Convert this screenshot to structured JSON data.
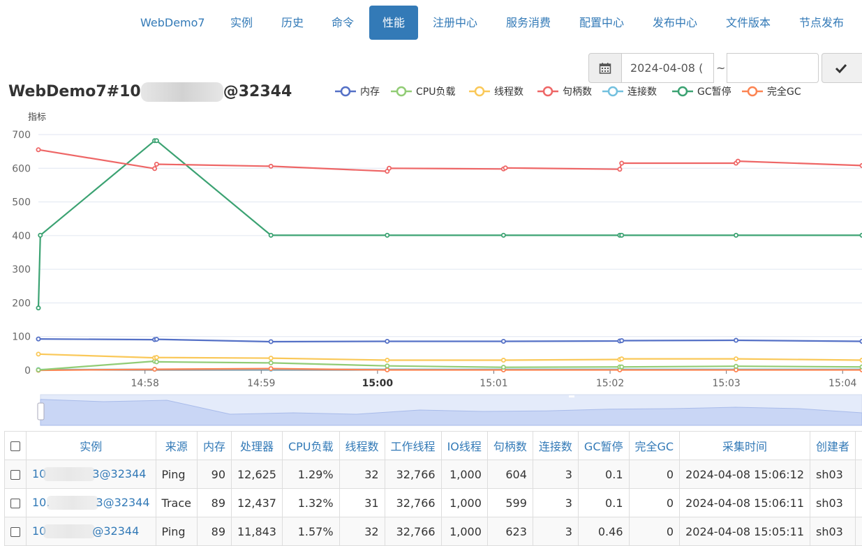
{
  "nav": {
    "items": [
      "WebDemo7",
      "实例",
      "历史",
      "命令",
      "性能",
      "注册中心",
      "服务消费",
      "配置中心",
      "发布中心",
      "文件版本",
      "节点发布"
    ],
    "active_index": 4
  },
  "datebar": {
    "start_date": "2024-04-08 (",
    "separator": "~",
    "end_date": "",
    "calendar_icon": "calendar-icon",
    "ok_icon": "check-icon"
  },
  "chart": {
    "title_prefix": "WebDemo7#10",
    "title_suffix": "@32344"
  },
  "chart_data": {
    "type": "line",
    "title": "WebDemo7#10…@32344",
    "ylabel": "指标",
    "ylim": [
      0,
      700
    ],
    "yticks": [
      0,
      100,
      200,
      300,
      400,
      500,
      600,
      700
    ],
    "xlim": [
      "14:57:05",
      "15:04:10"
    ],
    "xticks": [
      {
        "t": "14:58:00",
        "label": "14:58",
        "bold": false
      },
      {
        "t": "14:59:00",
        "label": "14:59",
        "bold": false
      },
      {
        "t": "15:00:00",
        "label": "15:00",
        "bold": true
      },
      {
        "t": "15:01:00",
        "label": "15:01",
        "bold": false
      },
      {
        "t": "15:02:00",
        "label": "15:02",
        "bold": false
      },
      {
        "t": "15:03:00",
        "label": "15:03",
        "bold": false
      },
      {
        "t": "15:04:00",
        "label": "15:04",
        "bold": false
      }
    ],
    "legend_position": "top",
    "grid": true,
    "series": [
      {
        "name": "内存",
        "color": "#5470c6",
        "points": [
          [
            "14:57:05",
            93
          ],
          [
            "14:58:05",
            91
          ],
          [
            "14:58:06",
            92
          ],
          [
            "14:59:05",
            85
          ],
          [
            "15:00:05",
            86
          ],
          [
            "15:01:05",
            86
          ],
          [
            "15:02:05",
            87
          ],
          [
            "15:02:06",
            88
          ],
          [
            "15:03:05",
            89
          ],
          [
            "15:04:10",
            86
          ]
        ]
      },
      {
        "name": "CPU负载",
        "color": "#91cc75",
        "points": [
          [
            "14:57:05",
            1
          ],
          [
            "14:58:05",
            27
          ],
          [
            "14:58:06",
            25
          ],
          [
            "14:59:05",
            22
          ],
          [
            "15:00:05",
            13
          ],
          [
            "15:01:05",
            9
          ],
          [
            "15:02:05",
            10
          ],
          [
            "15:02:06",
            10
          ],
          [
            "15:03:05",
            12
          ],
          [
            "15:04:10",
            10
          ]
        ]
      },
      {
        "name": "线程数",
        "color": "#fac858",
        "points": [
          [
            "14:57:05",
            48
          ],
          [
            "14:58:05",
            37
          ],
          [
            "14:58:06",
            38
          ],
          [
            "14:59:05",
            36
          ],
          [
            "15:00:05",
            30
          ],
          [
            "15:01:05",
            30
          ],
          [
            "15:02:05",
            32
          ],
          [
            "15:02:06",
            34
          ],
          [
            "15:03:05",
            34
          ],
          [
            "15:04:10",
            30
          ]
        ]
      },
      {
        "name": "句柄数",
        "color": "#ee6666",
        "points": [
          [
            "14:57:05",
            655
          ],
          [
            "14:58:05",
            599
          ],
          [
            "14:58:06",
            612
          ],
          [
            "14:59:05",
            606
          ],
          [
            "15:00:05",
            591
          ],
          [
            "15:00:06",
            600
          ],
          [
            "15:01:05",
            598
          ],
          [
            "15:01:06",
            601
          ],
          [
            "15:02:05",
            597
          ],
          [
            "15:02:06",
            615
          ],
          [
            "15:03:05",
            615
          ],
          [
            "15:03:06",
            621
          ],
          [
            "15:04:10",
            608
          ]
        ]
      },
      {
        "name": "连接数",
        "color": "#73c0de",
        "points": [
          [
            "14:57:05",
            2
          ],
          [
            "14:58:05",
            3
          ],
          [
            "14:59:05",
            3
          ],
          [
            "15:00:05",
            3
          ],
          [
            "15:01:05",
            3
          ],
          [
            "15:02:05",
            3
          ],
          [
            "15:03:05",
            3
          ],
          [
            "15:04:10",
            3
          ]
        ]
      },
      {
        "name": "GC暂停",
        "color": "#3ba272",
        "points": [
          [
            "14:57:05",
            185
          ],
          [
            "14:57:06",
            401
          ],
          [
            "14:58:05",
            682
          ],
          [
            "14:58:06",
            682
          ],
          [
            "14:59:05",
            401
          ],
          [
            "15:00:05",
            401
          ],
          [
            "15:01:05",
            401
          ],
          [
            "15:02:05",
            401
          ],
          [
            "15:02:06",
            401
          ],
          [
            "15:03:05",
            401
          ],
          [
            "15:04:10",
            401
          ]
        ]
      },
      {
        "name": "完全GC",
        "color": "#fc8452",
        "points": [
          [
            "14:57:05",
            0
          ],
          [
            "14:58:05",
            3
          ],
          [
            "14:59:05",
            5
          ],
          [
            "15:00:05",
            1
          ],
          [
            "15:01:05",
            1
          ],
          [
            "15:02:05",
            1
          ],
          [
            "15:03:05",
            1
          ],
          [
            "15:04:10",
            1
          ]
        ]
      }
    ],
    "overview": {
      "values": [
        93,
        85,
        90,
        40,
        45,
        40,
        55,
        50,
        52,
        58,
        60,
        65,
        60,
        45
      ]
    }
  },
  "table": {
    "headers": [
      "实例",
      "来源",
      "内存",
      "处理器",
      "CPU负载",
      "线程数",
      "工作线程",
      "IO线程",
      "句柄数",
      "连接数",
      "GC暂停",
      "完全GC",
      "采集时间",
      "创建者"
    ],
    "rows": [
      {
        "inst_a": "10",
        "inst_b": "3@32344",
        "source": "Ping",
        "mem": "90",
        "cpu": "12,625",
        "load": "1.29%",
        "threads": "32",
        "work": "32,766",
        "io": "1,000",
        "handles": "604",
        "conn": "3",
        "gc": "0.1",
        "fullgc": "0",
        "time": "2024-04-08 15:06:12",
        "creator": "sh03"
      },
      {
        "inst_a": "10.",
        "inst_b": "3@32344",
        "source": "Trace",
        "mem": "89",
        "cpu": "12,437",
        "load": "1.32%",
        "threads": "31",
        "work": "32,766",
        "io": "1,000",
        "handles": "599",
        "conn": "3",
        "gc": "0.1",
        "fullgc": "0",
        "time": "2024-04-08 15:06:11",
        "creator": "sh03"
      },
      {
        "inst_a": "10",
        "inst_b": "@32344",
        "source": "Ping",
        "mem": "89",
        "cpu": "11,843",
        "load": "1.57%",
        "threads": "32",
        "work": "32,766",
        "io": "1,000",
        "handles": "623",
        "conn": "3",
        "gc": "0.46",
        "fullgc": "0",
        "time": "2024-04-08 15:05:11",
        "creator": "sh03"
      }
    ]
  }
}
